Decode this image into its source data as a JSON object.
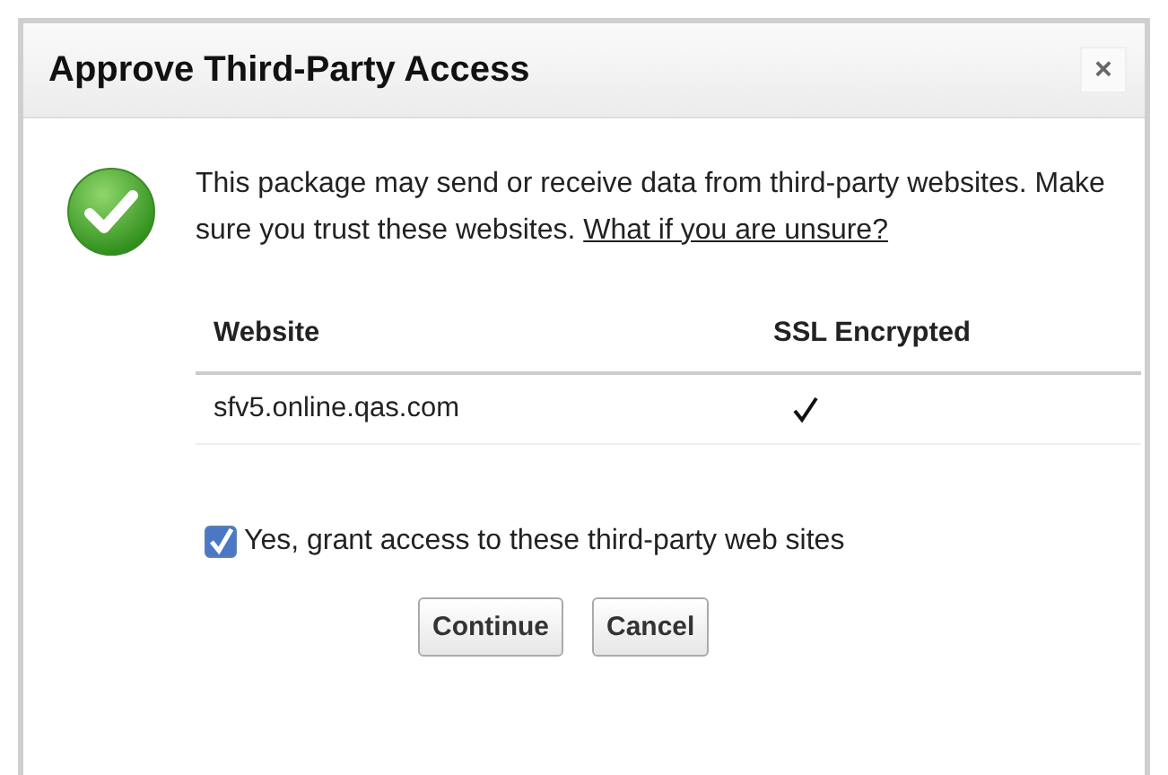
{
  "dialog": {
    "title": "Approve Third-Party Access",
    "close": "×"
  },
  "message": {
    "text": "This package may send or receive data from third-party websites. Make sure you trust these websites.",
    "link": "What if you are unsure?"
  },
  "table": {
    "columns": [
      "Website",
      "SSL Encrypted"
    ],
    "rows": [
      {
        "website": "sfv5.online.qas.com",
        "ssl_encrypted": true
      }
    ]
  },
  "grant": {
    "label": "Yes, grant access to these third-party web sites",
    "checked": true
  },
  "buttons": [
    "Continue",
    "Cancel"
  ]
}
